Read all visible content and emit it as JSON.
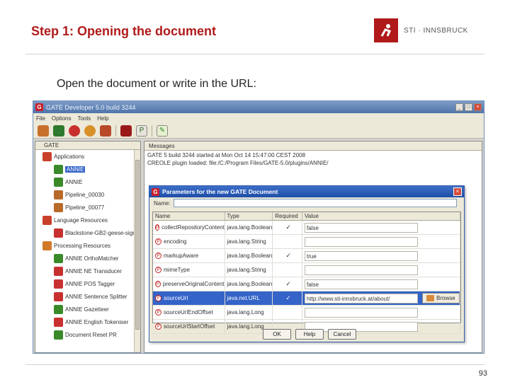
{
  "slide": {
    "title": "Step 1: Opening the document",
    "logo_text": "STI · INNSBRUCK",
    "intro": "Open the document or write in the URL:",
    "page_number": "93"
  },
  "app": {
    "title": "GATE Developer 5.0 build 3244",
    "menu": [
      "File",
      "Options",
      "Tools",
      "Help"
    ],
    "tree_tab": "GATE",
    "tree": [
      {
        "label": "Applications",
        "indent": 10,
        "color": "#c8402a"
      },
      {
        "label": "ANNIE",
        "indent": 26,
        "color": "#3a8a2a",
        "selected": true
      },
      {
        "label": "ANNIE",
        "indent": 26,
        "color": "#3a8a2a"
      },
      {
        "label": "Pipeline_00030",
        "indent": 26,
        "color": "#b86a2a"
      },
      {
        "label": "Pipeline_00077",
        "indent": 26,
        "color": "#b86a2a"
      },
      {
        "label": "Language Resources",
        "indent": 10,
        "color": "#c8402a"
      },
      {
        "label": "Blackstone-GB2-geese-sign",
        "indent": 26,
        "color": "#c83030"
      },
      {
        "label": "Processing Resources",
        "indent": 10,
        "color": "#d07a2a"
      },
      {
        "label": "ANNIE OrthoMatcher",
        "indent": 26,
        "color": "#3a8a2a"
      },
      {
        "label": "ANNIE NE Transducer",
        "indent": 26,
        "color": "#c83030"
      },
      {
        "label": "ANNIE POS Tagger",
        "indent": 26,
        "color": "#c83030"
      },
      {
        "label": "ANNIE Sentence Splitter",
        "indent": 26,
        "color": "#c83030"
      },
      {
        "label": "ANNIE Gazetteer",
        "indent": 26,
        "color": "#3a8a2a"
      },
      {
        "label": "ANNIE English Tokeniser",
        "indent": 26,
        "color": "#c83030"
      },
      {
        "label": "Document Reset PR",
        "indent": 26,
        "color": "#3a8a2a"
      }
    ],
    "messages_tab": "Messages",
    "messages": [
      "GATE 5 build 3244 started at Mon Oct 14 15:47:00 CEST 2008",
      "CREOLE plugin loaded: file:/C:/Program Files/GATE-5.0/plugins/ANNIE/"
    ]
  },
  "dialog": {
    "title": "Parameters for the new GATE Document",
    "name_label": "Name:",
    "columns": [
      "Name",
      "Type",
      "Required",
      "Value"
    ],
    "params": [
      {
        "name": "collectRepositoryContents",
        "type": "java.lang.Boolean",
        "required": true,
        "value": "false"
      },
      {
        "name": "encoding",
        "type": "java.lang.String",
        "required": false,
        "value": ""
      },
      {
        "name": "markupAware",
        "type": "java.lang.Boolean",
        "required": true,
        "value": "true"
      },
      {
        "name": "mimeType",
        "type": "java.lang.String",
        "required": false,
        "value": ""
      },
      {
        "name": "preserveOriginalContent",
        "type": "java.lang.Boolean",
        "required": true,
        "value": "false"
      },
      {
        "name": "sourceUrl",
        "type": "java.net.URL",
        "required": true,
        "value": "http://www.sti-innsbruck.at/about/",
        "selected": true,
        "browse": "Browse"
      },
      {
        "name": "sourceUrlEndOffset",
        "type": "java.lang.Long",
        "required": false,
        "value": ""
      },
      {
        "name": "sourceUrlStartOffset",
        "type": "java.lang.Long",
        "required": false,
        "value": ""
      }
    ],
    "buttons": [
      "OK",
      "Help",
      "Cancel"
    ]
  }
}
